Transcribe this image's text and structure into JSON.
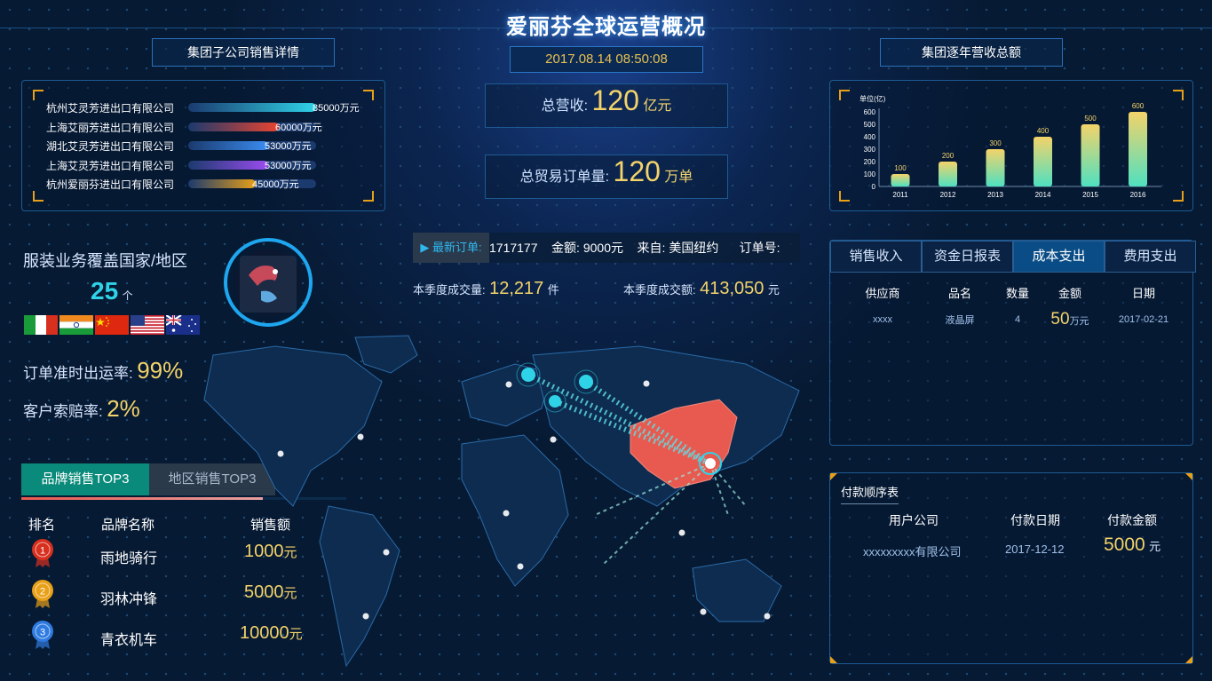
{
  "header": {
    "title": "爱丽芬全球运营概况",
    "datetime": "2017.08.14    08:50:08",
    "left_panel_title": "集团子公司销售详情",
    "right_panel_title": "集团逐年营收总额"
  },
  "subsidiaries": [
    {
      "name": "杭州艾灵芳进出口有限公司",
      "value": 85000,
      "label": "85000万元",
      "color": "#2fd3e8"
    },
    {
      "name": "上海艾丽芳进出口有限公司",
      "value": 60000,
      "label": "60000万元",
      "color": "#e8442f"
    },
    {
      "name": "湖北艾灵芳进出口有限公司",
      "value": 53000,
      "label": "53000万元",
      "color": "#3a8cf0"
    },
    {
      "name": "上海艾灵芳进出口有限公司",
      "value": 53000,
      "label": "53000万元",
      "color": "#9b4df0"
    },
    {
      "name": "杭州爱丽芬进出口有限公司",
      "value": 45000,
      "label": "45000万元",
      "color": "#e8a018"
    }
  ],
  "totals": {
    "revenue_label": "总营收:",
    "revenue_value": "120",
    "revenue_unit": "亿元",
    "orders_label": "总贸易订单量:",
    "orders_value": "120",
    "orders_unit": "万单"
  },
  "chart_data": {
    "type": "bar",
    "ylabel": "单位(亿)",
    "categories": [
      "2011",
      "2012",
      "2013",
      "2014",
      "2015",
      "2016"
    ],
    "values": [
      100,
      200,
      300,
      400,
      500,
      600
    ],
    "yticks": [
      0,
      100,
      200,
      300,
      400,
      500,
      600
    ],
    "ylim": [
      0,
      600
    ]
  },
  "coverage": {
    "label": "服装业务覆盖国家/地区",
    "count": "25",
    "unit": "个",
    "flags": [
      "italy-flag",
      "india-flag",
      "china-flag",
      "usa-flag",
      "australia-flag"
    ]
  },
  "rates": {
    "ontime_label": "订单准时出运率:",
    "ontime_value": "99%",
    "claim_label": "客户索赔率:",
    "claim_value": "2%"
  },
  "ticker": {
    "badge": "▶ 最新订单:",
    "text": "1717177    金额: 9000元    来自: 美国纽约      订单号:"
  },
  "quarter": {
    "volume_label": "本季度成交量:",
    "volume_value": "12,217",
    "volume_unit": "件",
    "amount_label": "本季度成交额:",
    "amount_value": "413,050",
    "amount_unit": "元"
  },
  "top3": {
    "tabs": [
      "品牌销售TOP3",
      "地区销售TOP3"
    ],
    "headers": [
      "排名",
      "品牌名称",
      "销售额"
    ],
    "rows": [
      {
        "rank": "1",
        "name": "雨地骑行",
        "sales": "1000",
        "unit": "元",
        "medal": "#d8301f"
      },
      {
        "rank": "2",
        "name": "羽林冲锋",
        "sales": "5000",
        "unit": "元",
        "medal": "#e8a018"
      },
      {
        "rank": "3",
        "name": "青衣机车",
        "sales": "10000",
        "unit": "元",
        "medal": "#2f7be0"
      }
    ]
  },
  "finance": {
    "tabs": [
      "销售收入",
      "资金日报表",
      "成本支出",
      "费用支出"
    ],
    "headers": [
      "供应商",
      "品名",
      "数量",
      "金额",
      "日期"
    ],
    "row": {
      "supplier": "xxxx",
      "product": "液晶屏",
      "qty": "4",
      "amount": "50",
      "unit": "万元",
      "date": "2017-02-21"
    }
  },
  "payment": {
    "title": "付款顺序表",
    "headers": [
      "用户公司",
      "付款日期",
      "付款金额"
    ],
    "row": {
      "company": "xxxxxxxxx有限公司",
      "date": "2017-12-12",
      "amount": "5000",
      "unit": "元"
    }
  },
  "colors": {
    "accent": "#f3d36a",
    "cyan": "#2fd3e8",
    "china": "#e85a4f",
    "tab_active": "#0a8a7a"
  }
}
